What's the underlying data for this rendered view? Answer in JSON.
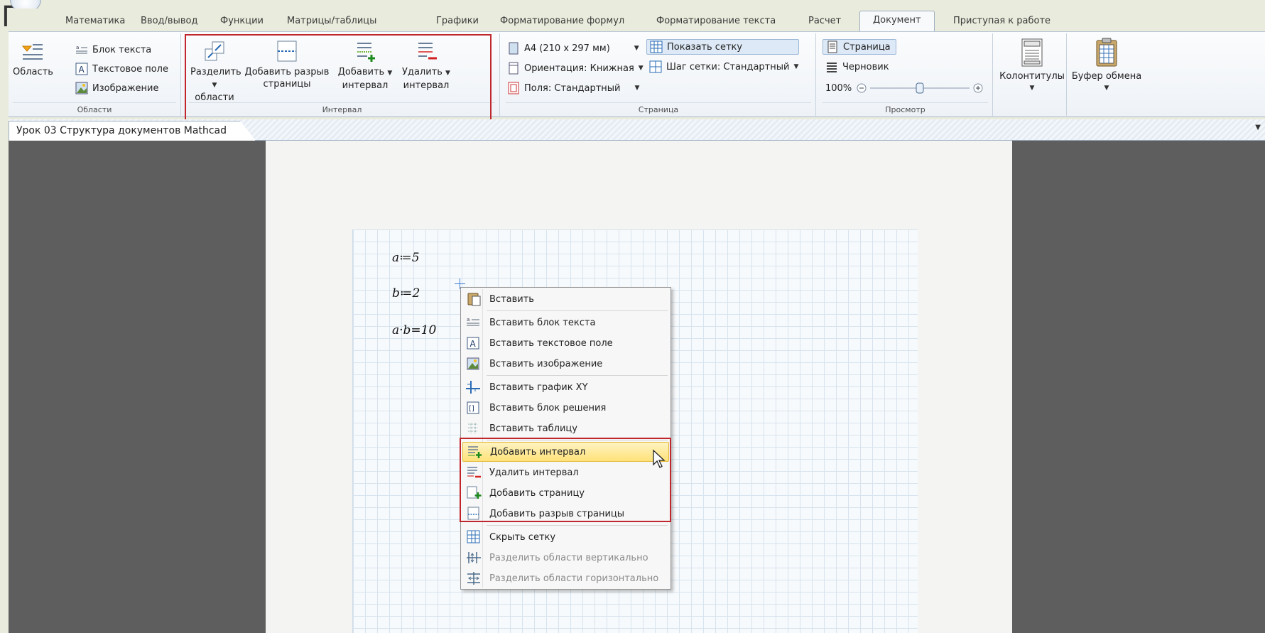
{
  "tabs": [
    "Математика",
    "Ввод/вывод",
    "Функции",
    "Матрицы/таблицы",
    "Графики",
    "Форматирование формул",
    "Форматирование текста",
    "Расчет",
    "Документ",
    "Приступая к работе"
  ],
  "active_tab": "Документ",
  "corner_glyph": "П",
  "help_label": "?",
  "ribbon": {
    "regions": {
      "label": "Области",
      "area_button": "Область",
      "text_block": "Блок текста",
      "text_field": "Текстовое поле",
      "image": "Изображение"
    },
    "interval": {
      "label": "Интервал",
      "split_line1": "Разделить",
      "split_line2": "области",
      "page_break_line1": "Добавить разрыв",
      "page_break_line2": "страницы",
      "add_line1": "Добавить",
      "add_line2": "интервал",
      "remove_line1": "Удалить",
      "remove_line2": "интервал"
    },
    "page": {
      "label": "Страница",
      "paper": "A4 (210 x 297 мм)",
      "orientation": "Ориентация: Книжная",
      "margins": "Поля: Стандартный",
      "show_grid": "Показать сетку",
      "grid_step": "Шаг сетки: Стандартный"
    },
    "view": {
      "label": "Просмотр",
      "page": "Страница",
      "draft": "Черновик",
      "zoom": "100%",
      "zoom_level": 0.5
    },
    "headers": "Колонтитулы",
    "clipboard": "Буфер обмена"
  },
  "document_tab": "Урок 03 Структура документов Mathcad",
  "math": [
    "a≔5",
    "b≔2",
    "a·b=10"
  ],
  "context_menu": [
    {
      "label": "Вставить",
      "icon": "paste-icon",
      "disabled": false
    },
    {
      "label": "Вставить блок текста",
      "icon": "text-block-icon",
      "disabled": false
    },
    {
      "label": "Вставить текстовое поле",
      "icon": "text-field-icon",
      "disabled": false
    },
    {
      "label": "Вставить изображение",
      "icon": "image-icon",
      "disabled": false
    },
    {
      "label": "Вставить график XY",
      "icon": "xy-plot-icon",
      "disabled": false
    },
    {
      "label": "Вставить блок решения",
      "icon": "solve-block-icon",
      "disabled": false
    },
    {
      "label": "Вставить таблицу",
      "icon": "table-icon",
      "disabled": false
    },
    {
      "label": "Добавить интервал",
      "icon": "add-interval-icon",
      "disabled": false,
      "highlighted": true
    },
    {
      "label": "Удалить интервал",
      "icon": "remove-interval-icon",
      "disabled": false
    },
    {
      "label": "Добавить страницу",
      "icon": "add-page-icon",
      "disabled": false
    },
    {
      "label": "Добавить разрыв страницы",
      "icon": "page-break-icon",
      "disabled": false
    },
    {
      "label": "Скрыть сетку",
      "icon": "grid-icon",
      "disabled": false
    },
    {
      "label": "Разделить области вертикально",
      "icon": "split-vertical-icon",
      "disabled": true
    },
    {
      "label": "Разделить области горизонтально",
      "icon": "split-horizontal-icon",
      "disabled": true
    }
  ],
  "colors": {
    "annotation_red": "#c0272d",
    "highlight": "#ffe27a",
    "workspace_dark": "#5e5e5e",
    "grid_line": "#d7e3ee"
  }
}
